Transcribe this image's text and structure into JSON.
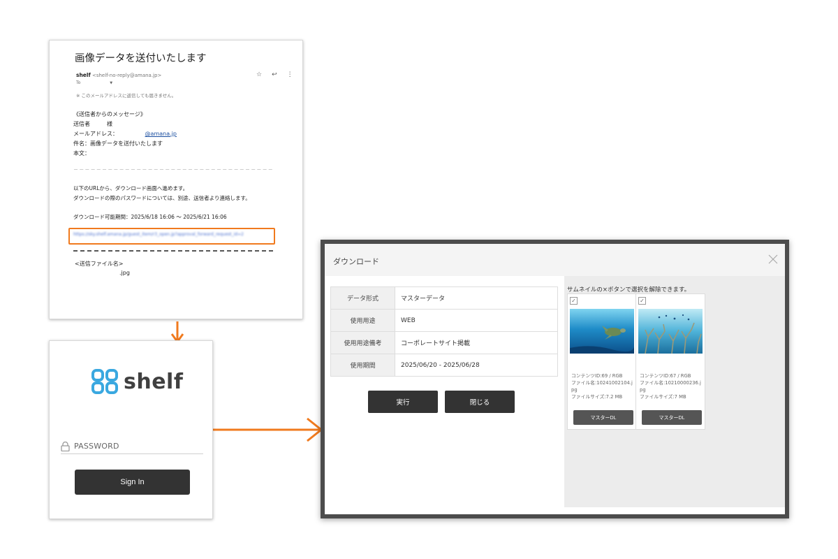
{
  "email": {
    "subject": "画像データを送付いたします",
    "sender_name": "shelf",
    "sender_addr": "<shelf-no-reply@amana.jp>",
    "to_label": "To",
    "notice": "※ このメールアドレスに返信しても届きません。",
    "msg_header": "《送信者からのメッセージ》",
    "sender_line": "送信者　　　様",
    "mail_label": "メールアドレス：",
    "mail_domain": "@amana.jp",
    "subject_line": "件名：画像データを送付いたします",
    "body_label": "本文：",
    "divider": "－－－－－－－－－－－－－－－－－－－－－－－－－－－－－－－－－－－－－－",
    "url_intro1": "以下のURLから、ダウンロード画面へ進めます。",
    "url_intro2": "ダウンロードの際のパスワードについては、別途、送信者より連絡します。",
    "period": "ダウンロード可能期間：2025/6/18 16:06 ～ 2025/6/21 16:06",
    "url": "https://sky.shelf.amana.jp/guest_item/r3_open.jp?approval_forward_request_id=2",
    "attach_label": "<送信ファイル名>",
    "attach_file": ".jpg"
  },
  "login": {
    "logo_text": "shelf",
    "password_label": "PASSWORD",
    "signin_label": "Sign In"
  },
  "dialog": {
    "title": "ダウンロード",
    "rows": [
      {
        "key": "データ形式",
        "value": "マスターデータ"
      },
      {
        "key": "使用用途",
        "value": "WEB"
      },
      {
        "key": "使用用途備考",
        "value": "コーポレートサイト掲載"
      },
      {
        "key": "使用期間",
        "value": "2025/06/20 - 2025/06/28"
      }
    ],
    "exec_label": "実行",
    "close_label": "閉じる",
    "hint": "サムネイルの×ボタンで選択を解除できます。",
    "items": [
      {
        "id_line": "コンテンツID:69 / RGB",
        "fname_line": "ファイル名:10241002104.jpg",
        "size_line": "ファイルサイズ:7.2 MB",
        "dl_label": "マスターDL"
      },
      {
        "id_line": "コンテンツID:67 / RGB",
        "fname_line": "ファイル名:10210000236.jpg",
        "size_line": "ファイルサイズ:7 MB",
        "dl_label": "マスターDL"
      }
    ]
  },
  "colors": {
    "accent_orange": "#f07a1e",
    "logo_blue": "#3aa8e0",
    "button_dark": "#333333"
  }
}
